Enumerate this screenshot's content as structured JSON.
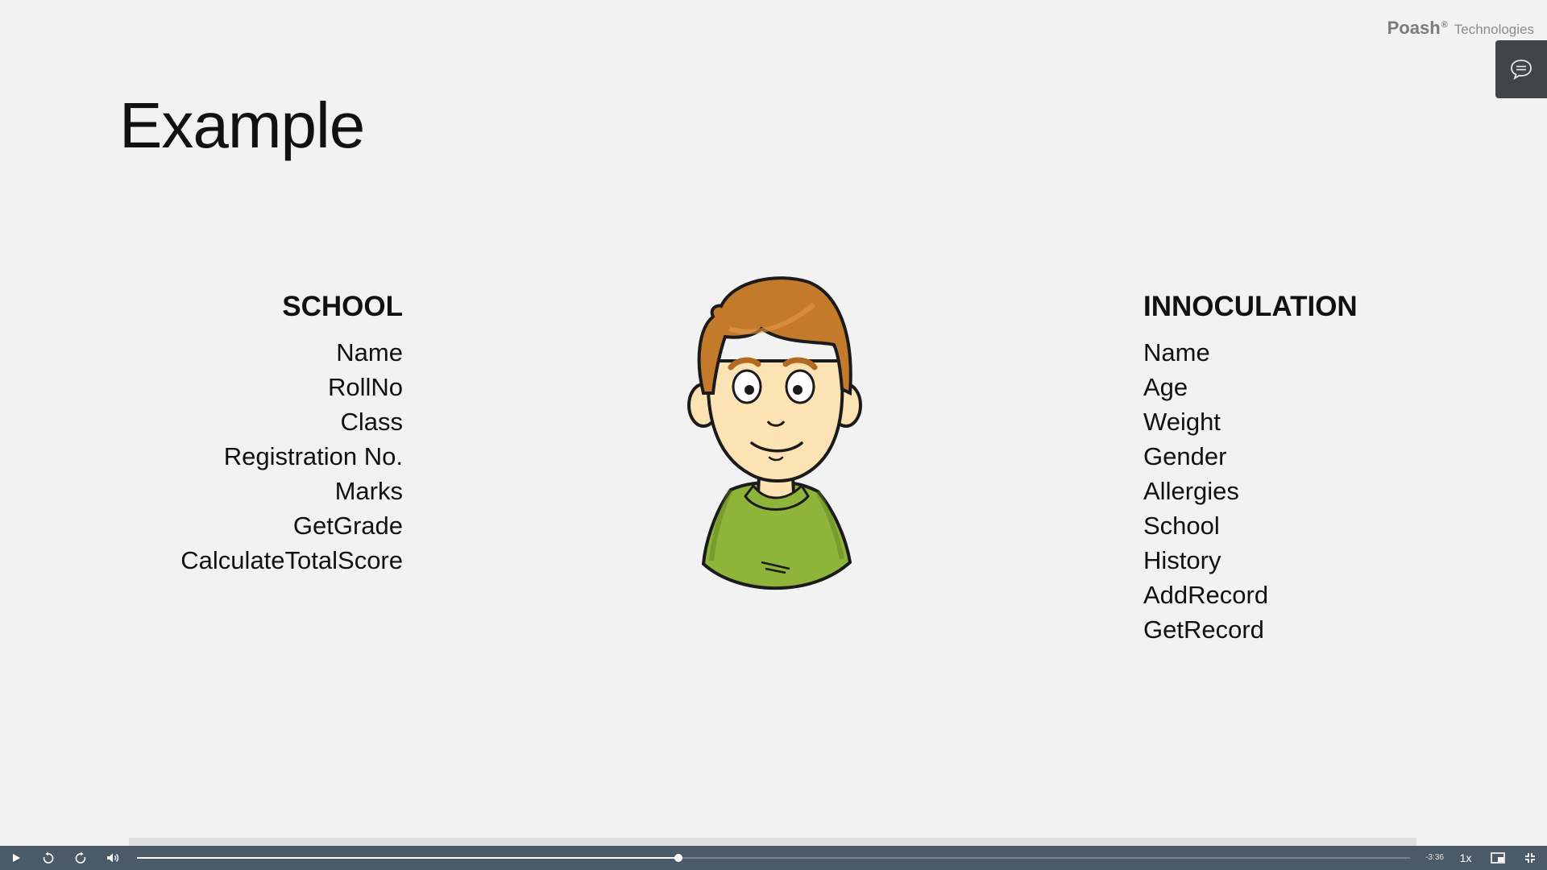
{
  "brand": {
    "name": "Poash",
    "reg": "®",
    "suffix": "Technologies"
  },
  "slide": {
    "title": "Example",
    "school": {
      "heading": "SCHOOL",
      "items": [
        "Name",
        "RollNo",
        "Class",
        "Registration No.",
        "Marks",
        "GetGrade",
        "CalculateTotalScore"
      ]
    },
    "innoculation": {
      "heading": "INNOCULATION",
      "items": [
        "Name",
        "Age",
        "Weight",
        "Gender",
        "Allergies",
        "School",
        "History",
        "AddRecord",
        "GetRecord"
      ]
    }
  },
  "player": {
    "time_remaining": "-3:36",
    "speed": "1x",
    "progress": 0.425,
    "icons": [
      "play-icon",
      "rewind-icon",
      "forward-icon",
      "volume-icon",
      "pip-icon",
      "fullscreen-exit-icon",
      "chat-icon"
    ]
  },
  "colors": {
    "background": "#f2f2f2",
    "control_bar": "#4a5a69",
    "chat_button": "#3f4549",
    "hair": "#c47a2b",
    "shirt": "#8fb43a"
  }
}
